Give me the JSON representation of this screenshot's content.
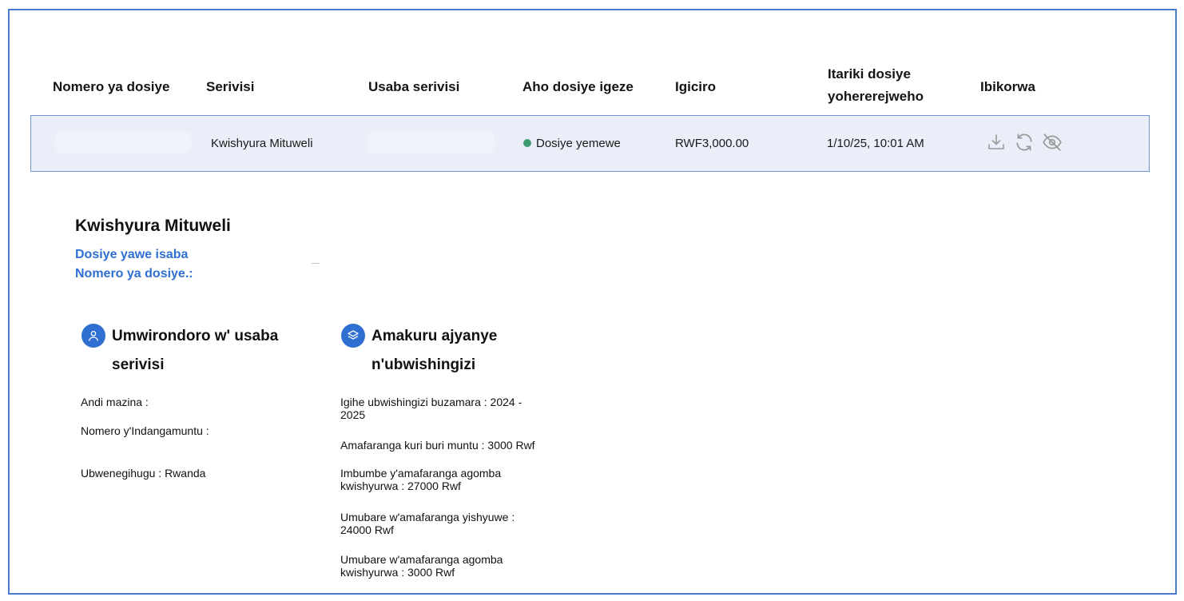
{
  "table": {
    "headers": {
      "file_number": "Nomero ya dosiye",
      "service": "Serivisi",
      "requester": "Usaba serivisi",
      "status": "Aho dosiye igeze",
      "price": "Igiciro",
      "date_line1": "Itariki dosiye",
      "date_line2": "yohererejweho",
      "actions": "Ibikorwa"
    },
    "row": {
      "service": "Kwishyura Mituweli",
      "status": "Dosiye yemewe",
      "status_color": "#3d9c6e",
      "price": "RWF3,000.00",
      "date": "1/10/25, 10:01 AM"
    },
    "action_icons": [
      "download-icon",
      "refresh-icon",
      "eye-slash-icon"
    ]
  },
  "detail": {
    "title": "Kwishyura Mituweli",
    "request_label": "Dosiye yawe isaba",
    "file_number_label": "Nomero ya dosiye.:",
    "profile": {
      "title_line1": "Umwirondoro w' usaba",
      "title_line2": "serivisi",
      "icon": "user-icon",
      "fields": {
        "names": "Andi mazina :",
        "id_number": "Nomero y'Indangamuntu :",
        "nationality": "Ubwenegihugu : Rwanda"
      }
    },
    "contribution": {
      "title_line1": "Amakuru ajyanye",
      "title_line2": "n'ubwishingizi",
      "icon": "layers-icon",
      "fields": {
        "period_line1": "Igihe ubwishingizi buzamara : 2024 -",
        "period_line2": "2025",
        "per_person": "Amafaranga kuri buri muntu : 3000 Rwf",
        "total_due_line1": "Imbumbe y'amafaranga agomba",
        "total_due_line2": "kwishyurwa : 27000 Rwf",
        "paid_line1": "Umubare w'amafaranga yishyuwe :",
        "paid_line2": "24000 Rwf",
        "remaining_line1": "Umubare w'amafaranga agomba",
        "remaining_line2": "kwishyurwa : 3000 Rwf"
      }
    }
  },
  "colors": {
    "accent": "#2f6fd1",
    "frame_border": "#4a7bd0",
    "row_bg": "#e9eef8"
  }
}
